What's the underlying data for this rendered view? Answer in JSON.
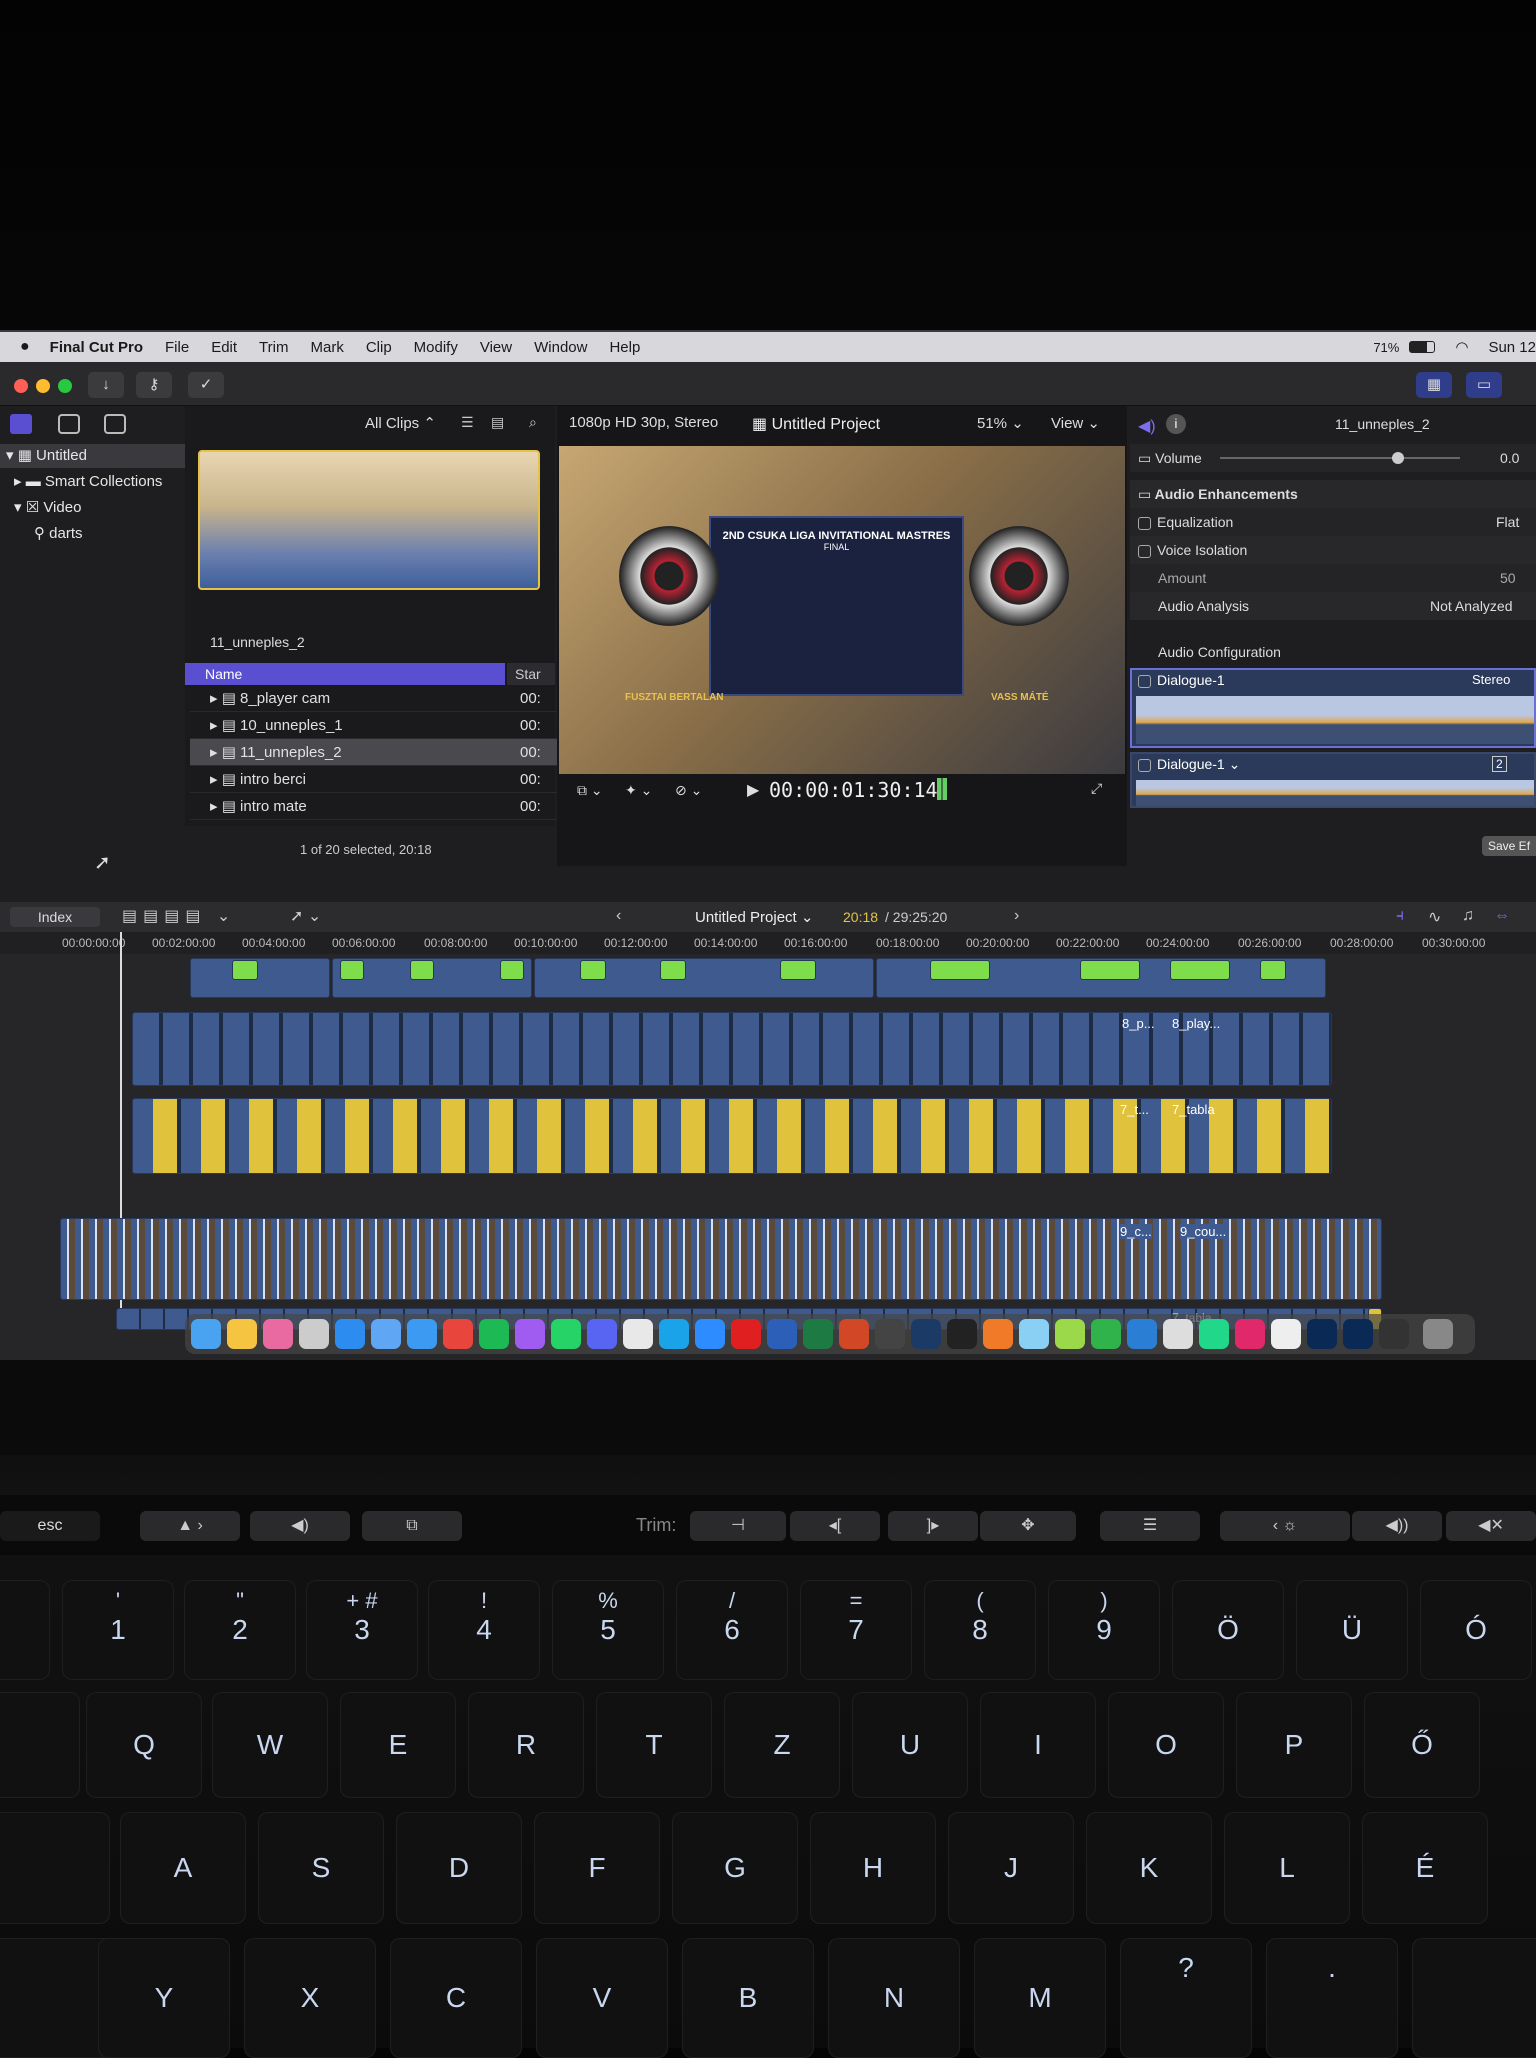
{
  "menu": {
    "app": "Final Cut Pro",
    "items": [
      "File",
      "Edit",
      "Trim",
      "Mark",
      "Clip",
      "Modify",
      "View",
      "Window",
      "Help"
    ],
    "battery": "71%",
    "clock": "Sun 12"
  },
  "browser": {
    "filter": "All Clips",
    "library": "Untitled",
    "sidebar": [
      "Smart Collections",
      "Video",
      "darts"
    ],
    "clip_name": "11_unneples_2",
    "col_name": "Name",
    "col_start": "Star",
    "rows": [
      {
        "name": "8_player cam",
        "start": "00:"
      },
      {
        "name": "10_unneples_1",
        "start": "00:"
      },
      {
        "name": "11_unneples_2",
        "start": "00:"
      },
      {
        "name": "intro berci",
        "start": "00:"
      },
      {
        "name": "intro mate",
        "start": "00:"
      }
    ],
    "status": "1 of 20 selected, 20:18"
  },
  "viewer": {
    "format": "1080p HD 30p, Stereo",
    "project": "Untitled Project",
    "zoom": "51%",
    "view": "View",
    "timecode": "00:00:01:30:14",
    "overlay_title": "2ND CSUKA LIGA INVITATIONAL MASTRES",
    "overlay_sub": "FINAL",
    "player_left": "FUSZTAI BERTALAN",
    "player_right": "VASS MÁTÉ"
  },
  "inspector": {
    "clip": "11_unneples_2",
    "volume_label": "Volume",
    "volume_value": "0.0",
    "enhancements": "Audio Enhancements",
    "equalization": "Equalization",
    "eq_value": "Flat",
    "voice_isolation": "Voice Isolation",
    "amount": "Amount",
    "amount_value": "50",
    "analysis": "Audio Analysis",
    "analysis_value": "Not Analyzed",
    "configuration": "Audio Configuration",
    "channels": [
      {
        "name": "Dialogue-1",
        "format": "Stereo"
      },
      {
        "name": "Dialogue-1",
        "format": "2"
      }
    ],
    "save": "Save Ef"
  },
  "timeline": {
    "index": "Index",
    "project": "Untitled Project",
    "position": "20:18",
    "duration": "29:25:20",
    "ruler": [
      "00:00:00:00",
      "00:02:00:00",
      "00:04:00:00",
      "00:06:00:00",
      "00:08:00:00",
      "00:10:00:00",
      "00:12:00:00",
      "00:14:00:00",
      "00:16:00:00",
      "00:18:00:00",
      "00:20:00:00",
      "00:22:00:00",
      "00:24:00:00",
      "00:26:00:00",
      "00:28:00:00",
      "00:30:00:00"
    ],
    "clip_labels": [
      "8_play...",
      "8_p...",
      "7_tabla",
      "7_t...",
      "9_cou...",
      "9_c...",
      "7_tabla"
    ]
  },
  "keyboard": {
    "touchbar_label": "Trim:",
    "esc": "esc",
    "row_num": [
      "1",
      "2",
      "3",
      "4",
      "5",
      "6",
      "7",
      "8",
      "9",
      "Ö",
      "Ü",
      "Ó"
    ],
    "row_num_top": [
      "'",
      "\"",
      "+ #",
      "!",
      "%",
      "/",
      "=",
      "(",
      ")"
    ],
    "row_q": [
      "Q",
      "W",
      "E",
      "R",
      "T",
      "Z",
      "U",
      "I",
      "O",
      "P",
      "Ő"
    ],
    "row_a": [
      "A",
      "S",
      "D",
      "F",
      "G",
      "H",
      "J",
      "K",
      "L",
      "É"
    ],
    "row_y": [
      "Y",
      "X",
      "C",
      "V",
      "B",
      "N",
      "M"
    ],
    "row_y_extra": [
      "?",
      "."
    ]
  }
}
